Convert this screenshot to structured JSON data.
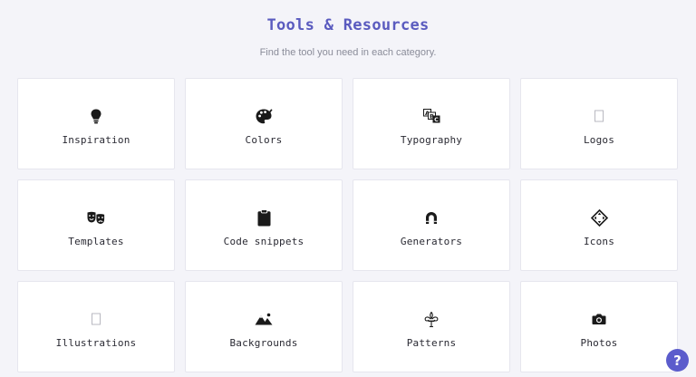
{
  "header": {
    "title": "Tools & Resources",
    "subtitle": "Find the tool you need in each category."
  },
  "colors": {
    "accent": "#5a5bbf",
    "background": "#f4f4f9",
    "card": "#ffffff"
  },
  "categories": [
    {
      "label": "Inspiration",
      "icon": "lightbulb-icon"
    },
    {
      "label": "Colors",
      "icon": "palette-icon"
    },
    {
      "label": "Typography",
      "icon": "spell-check-icon"
    },
    {
      "label": "Logos",
      "icon": "missing-glyph-icon"
    },
    {
      "label": "Templates",
      "icon": "theater-masks-icon"
    },
    {
      "label": "Code snippets",
      "icon": "clipboard-icon"
    },
    {
      "label": "Generators",
      "icon": "magnet-icon"
    },
    {
      "label": "Icons",
      "icon": "diamond-arrows-icon"
    },
    {
      "label": "Illustrations",
      "icon": "missing-glyph-icon"
    },
    {
      "label": "Backgrounds",
      "icon": "mountain-icon"
    },
    {
      "label": "Patterns",
      "icon": "fleur-de-lis-icon"
    },
    {
      "label": "Photos",
      "icon": "camera-icon"
    }
  ],
  "help": {
    "label": "?",
    "icon": "question-icon"
  }
}
